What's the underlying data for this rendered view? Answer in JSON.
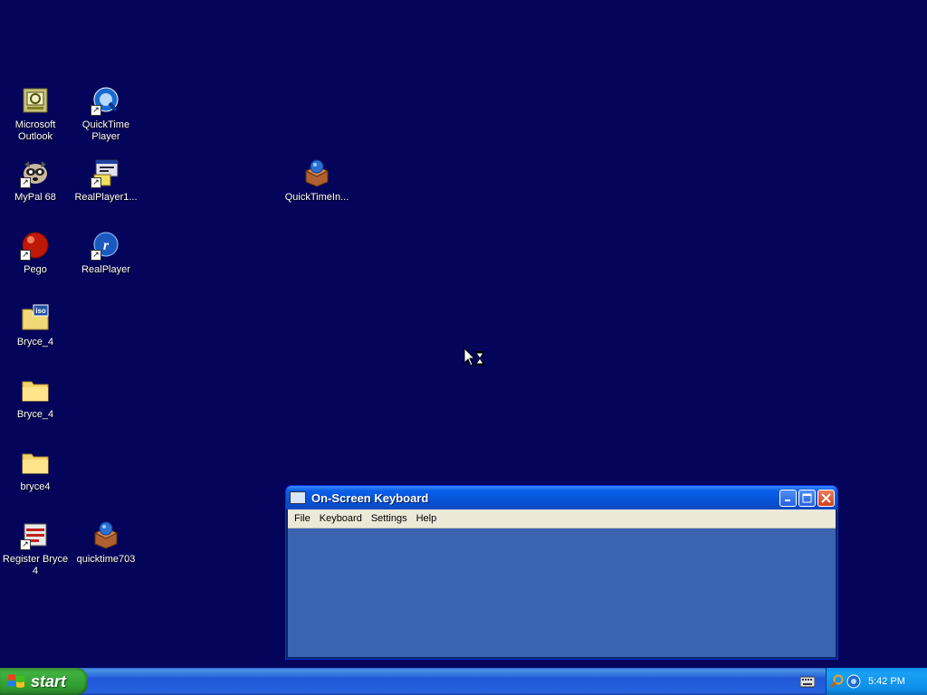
{
  "desktop": {
    "icons": [
      {
        "label": "Microsoft\nOutlook",
        "icon": "outlook-icon"
      },
      {
        "label": "QuickTime\nPlayer",
        "icon": "quicktime-icon"
      },
      {
        "label": "MyPal 68",
        "icon": "raccoon-icon"
      },
      {
        "label": "RealPlayer1...",
        "icon": "realplayer-installer-icon"
      },
      {
        "label": "QuickTimeIn...",
        "icon": "installer-box-icon"
      },
      {
        "label": "Pego",
        "icon": "red-ball-icon"
      },
      {
        "label": "RealPlayer",
        "icon": "realplayer-icon"
      },
      {
        "label": "Bryce_4",
        "icon": "iso-file-icon"
      },
      {
        "label": "Bryce_4",
        "icon": "folder-icon"
      },
      {
        "label": "bryce4",
        "icon": "folder-icon"
      },
      {
        "label": "Register Bryce\n4",
        "icon": "register-icon"
      },
      {
        "label": "quicktime703",
        "icon": "installer-box-icon"
      }
    ]
  },
  "osk_window": {
    "title": "On-Screen Keyboard",
    "menu": [
      "File",
      "Keyboard",
      "Settings",
      "Help"
    ]
  },
  "taskbar": {
    "start_label": "start",
    "clock": "5:42 PM"
  },
  "colors": {
    "desktop": "#04045a",
    "taskbar": "#2157d7",
    "start_button": "#3eb13e",
    "window_client": "#3a64b0"
  }
}
